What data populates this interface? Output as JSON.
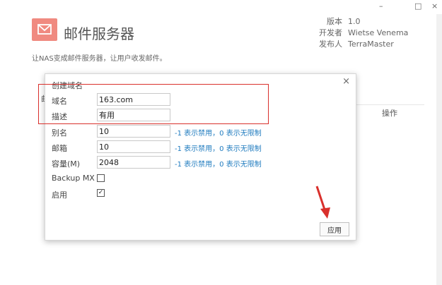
{
  "window": {
    "minimize": "–",
    "maximize": "□",
    "close": "×"
  },
  "app": {
    "title": "邮件服务器",
    "icon": "envelope-icon",
    "description": "让NAS变成邮件服务器，让用户收发邮件。",
    "meta": [
      {
        "key": "版本",
        "value": "1.0"
      },
      {
        "key": "开发者",
        "value": "Wietse Venema"
      },
      {
        "key": "发布人",
        "value": "TerraMaster"
      }
    ],
    "column_operation": "操作",
    "peek_text": "邮"
  },
  "dialog": {
    "title": "创建域名",
    "close": "×",
    "fields": {
      "domain": {
        "label": "域名",
        "value": "163.com"
      },
      "description": {
        "label": "描述",
        "value": "有用"
      },
      "alias": {
        "label": "别名",
        "value": "10",
        "hint": "-1 表示禁用，0 表示无限制"
      },
      "mailbox": {
        "label": "邮箱",
        "value": "10",
        "hint": "-1 表示禁用，0 表示无限制"
      },
      "capacity": {
        "label": "容量(M)",
        "value": "2048",
        "hint": "-1 表示禁用，0 表示无限制"
      },
      "backup_mx": {
        "label": "Backup MX",
        "checked": false
      },
      "enabled": {
        "label": "启用",
        "checked": true,
        "mark": "✓"
      }
    },
    "apply_label": "应用"
  },
  "colors": {
    "accent_icon": "#f08a80",
    "annotation": "#d9302c",
    "hint": "#1f7bbf"
  }
}
